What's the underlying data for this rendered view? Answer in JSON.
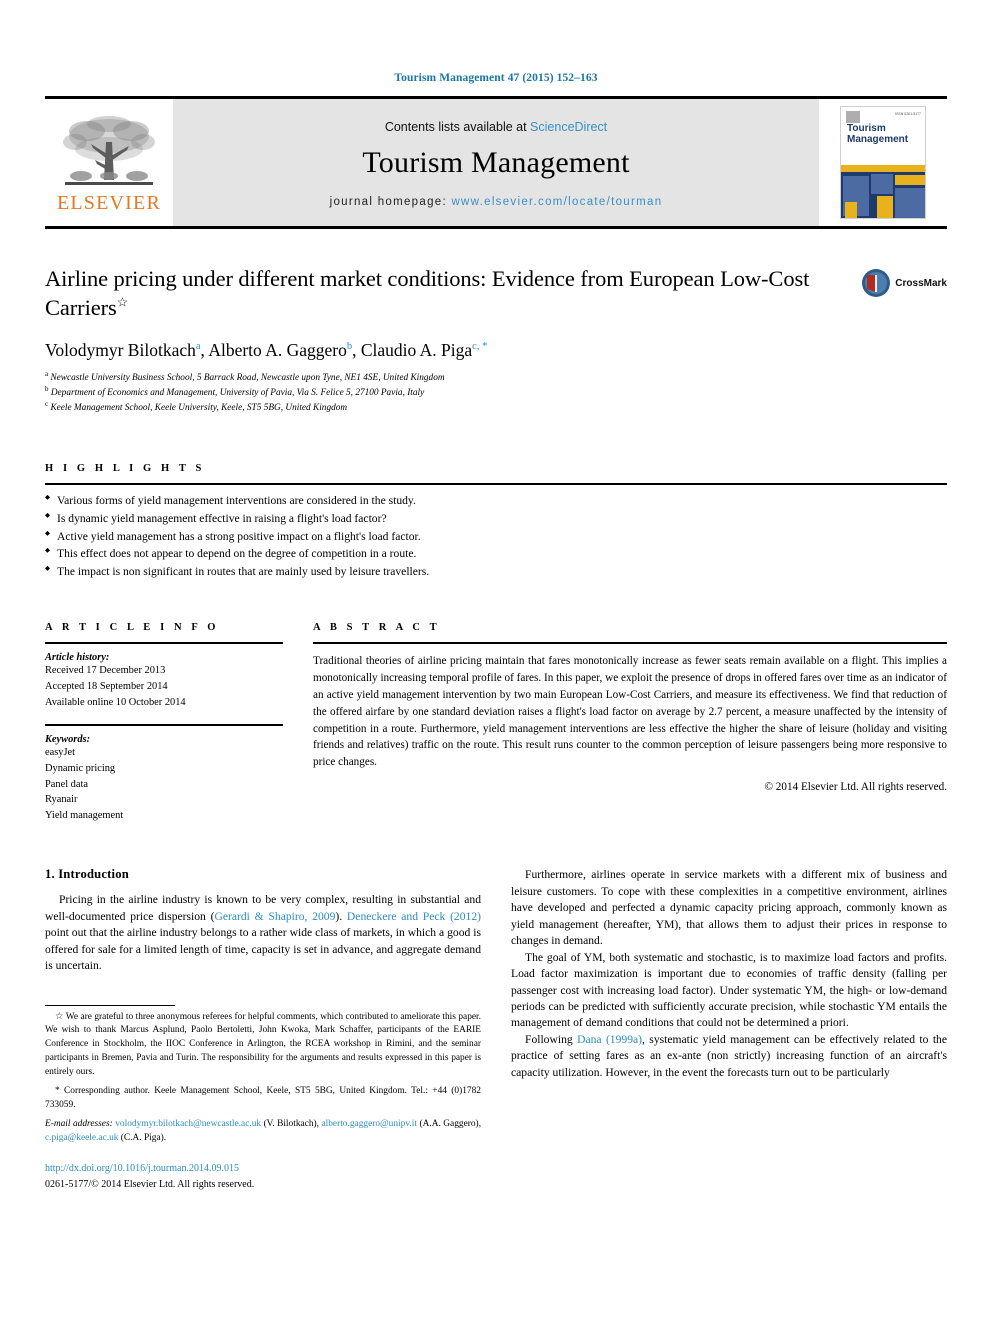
{
  "running_head": "Tourism Management 47 (2015) 152–163",
  "masthead": {
    "publisher_logo_text": "ELSEVIER",
    "contents_prefix": "Contents lists available at ",
    "contents_link": "ScienceDirect",
    "journal_name": "Tourism Management",
    "homepage_prefix": "journal homepage: ",
    "homepage_url": "www.elsevier.com/locate/tourman",
    "cover_title_line1": "Tourism",
    "cover_title_line2": "Management",
    "cover_issn": "ISSN 0261-5177"
  },
  "article": {
    "title": "Airline pricing under different market conditions: Evidence from European Low-Cost Carriers",
    "title_marker": "☆",
    "crossmark_label": "CrossMark",
    "authors": [
      {
        "name": "Volodymyr Bilotkach",
        "marker": "a"
      },
      {
        "name": "Alberto A. Gaggero",
        "marker": "b"
      },
      {
        "name": "Claudio A. Piga",
        "marker": "c, *"
      }
    ],
    "affiliations": [
      {
        "marker": "a",
        "text": "Newcastle University Business School, 5 Barrack Road, Newcastle upon Tyne, NE1 4SE, United Kingdom"
      },
      {
        "marker": "b",
        "text": "Department of Economics and Management, University of Pavia, Via S. Felice 5, 27100 Pavia, Italy"
      },
      {
        "marker": "c",
        "text": "Keele Management School, Keele University, Keele, ST5 5BG, United Kingdom"
      }
    ]
  },
  "highlights": {
    "label": "H I G H L I G H T S",
    "items": [
      "Various forms of yield management interventions are considered in the study.",
      "Is dynamic yield management effective in raising a flight's load factor?",
      "Active yield management has a strong positive impact on a flight's load factor.",
      "This effect does not appear to depend on the degree of competition in a route.",
      "The impact is non significant in routes that are mainly used by leisure travellers."
    ]
  },
  "article_info": {
    "label": "A R T I C L E  I N F O",
    "history_head": "Article history:",
    "history": [
      "Received 17 December 2013",
      "Accepted 18 September 2014",
      "Available online 10 October 2014"
    ],
    "keywords_head": "Keywords:",
    "keywords": [
      "easyJet",
      "Dynamic pricing",
      "Panel data",
      "Ryanair",
      "Yield management"
    ]
  },
  "abstract": {
    "label": "A B S T R A C T",
    "text": "Traditional theories of airline pricing maintain that fares monotonically increase as fewer seats remain available on a flight. This implies a monotonically increasing temporal profile of fares. In this paper, we exploit the presence of drops in offered fares over time as an indicator of an active yield management intervention by two main European Low-Cost Carriers, and measure its effectiveness. We find that reduction of the offered airfare by one standard deviation raises a flight's load factor on average by 2.7 percent, a measure unaffected by the intensity of competition in a route. Furthermore, yield management interventions are less effective the higher the share of leisure (holiday and visiting friends and relatives) traffic on the route. This result runs counter to the common perception of leisure passengers being more responsive to price changes.",
    "copyright": "© 2014 Elsevier Ltd. All rights reserved."
  },
  "introduction": {
    "heading": "1. Introduction",
    "left_p1_a": "Pricing in the airline industry is known to be very complex, resulting in substantial and well-documented price dispersion (",
    "left_p1_ref1": "Gerardi & Shapiro, 2009",
    "left_p1_b": "). ",
    "left_p1_ref2": "Deneckere and Peck (2012)",
    "left_p1_c": " point out that the airline industry belongs to a rather wide class of markets, in which a good is offered for sale for a limited length of time, capacity is set in advance, and aggregate demand is uncertain.",
    "right_p1": "Furthermore, airlines operate in service markets with a different mix of business and leisure customers. To cope with these complexities in a competitive environment, airlines have developed and perfected a dynamic capacity pricing approach, commonly known as yield management (hereafter, YM), that allows them to adjust their prices in response to changes in demand.",
    "right_p2": "The goal of YM, both systematic and stochastic, is to maximize load factors and profits. Load factor maximization is important due to economies of traffic density (falling per passenger cost with increasing load factor). Under systematic YM, the high- or low-demand periods can be predicted with sufficiently accurate precision, while stochastic YM entails the management of demand conditions that could not be determined a priori.",
    "right_p3_a": "Following ",
    "right_p3_ref": "Dana (1999a)",
    "right_p3_b": ", systematic yield management can be effectively related to the practice of setting fares as an ex-ante (non strictly) increasing function of an aircraft's capacity utilization. However, in the event the forecasts turn out to be particularly"
  },
  "footnotes": {
    "star": "☆ We are grateful to three anonymous referees for helpful comments, which contributed to ameliorate this paper. We wish to thank Marcus Asplund, Paolo Bertoletti, John Kwoka, Mark Schaffer, participants of the EARIE Conference in Stockholm, the IIOC Conference in Arlington, the RCEA workshop in Rimini, and the seminar participants in Bremen, Pavia and Turin. The responsibility for the arguments and results expressed in this paper is entirely ours.",
    "corresponding": "* Corresponding author. Keele Management School, Keele, ST5 5BG, United Kingdom. Tel.: +44 (0)1782 733059.",
    "email_label": "E-mail addresses:",
    "emails": [
      {
        "address": "volodymyr.bilotkach@newcastle.ac.uk",
        "owner": "(V. Bilotkach)"
      },
      {
        "address": "alberto.gaggero@unipv.it",
        "owner": "(A.A. Gaggero)"
      },
      {
        "address": "c.piga@keele.ac.uk",
        "owner": "(C.A. Piga)"
      }
    ],
    "doi": "http://dx.doi.org/10.1016/j.tourman.2014.09.015",
    "issn_line": "0261-5177/© 2014 Elsevier Ltd. All rights reserved."
  },
  "colors": {
    "link_blue": "#2b8cbe",
    "running_head_blue": "#1a75a8",
    "elsevier_orange": "#E87722",
    "masthead_grey": "#e4e4e4",
    "cover_navy": "#1f3a6e",
    "cover_yellow": "#e8b21d",
    "crossmark_red": "#b32b1f"
  }
}
